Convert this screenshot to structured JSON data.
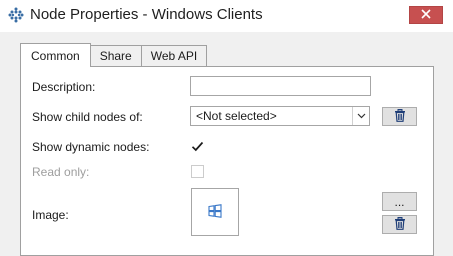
{
  "window": {
    "title": "Node Properties - Windows Clients",
    "app_icon": "grid-dots-icon",
    "close_icon": "close-icon"
  },
  "tabs": [
    {
      "label": "Common",
      "active": true
    },
    {
      "label": "Share",
      "active": false
    },
    {
      "label": "Web API",
      "active": false
    }
  ],
  "form": {
    "description_label": "Description:",
    "description_value": "",
    "child_nodes_label": "Show child nodes  of:",
    "child_nodes_value": "<Not selected>",
    "dynamic_nodes_label": "Show dynamic nodes:",
    "dynamic_nodes_checked": true,
    "read_only_label": "Read only:",
    "read_only_checked": false,
    "read_only_enabled": false,
    "image_label": "Image:",
    "image_icon": "windows-logo-icon",
    "browse_button_label": "...",
    "delete_icon": "trash-icon"
  },
  "colors": {
    "close_button": "#c75050",
    "accent": "#3a6ea5",
    "window_bg": "#f0f0f0",
    "panel_bg": "#ffffff"
  }
}
